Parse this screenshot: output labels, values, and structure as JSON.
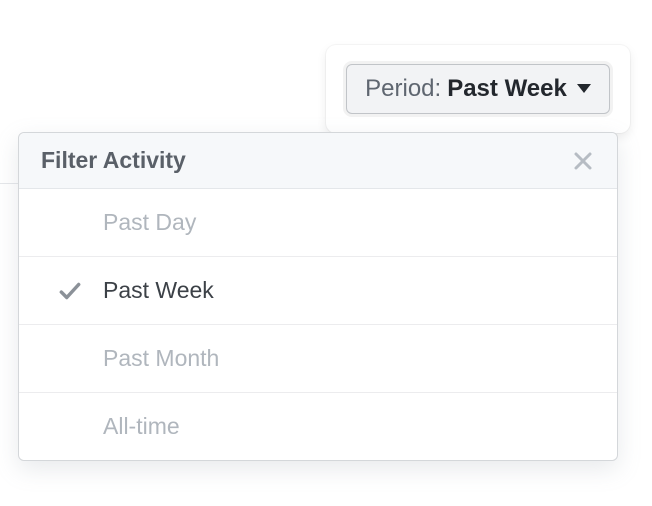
{
  "period_selector": {
    "label": "Period: ",
    "value": "Past Week"
  },
  "dropdown": {
    "title": "Filter Activity",
    "items": [
      {
        "label": "Past Day",
        "selected": false
      },
      {
        "label": "Past Week",
        "selected": true
      },
      {
        "label": "Past Month",
        "selected": false
      },
      {
        "label": "All-time",
        "selected": false
      }
    ]
  }
}
